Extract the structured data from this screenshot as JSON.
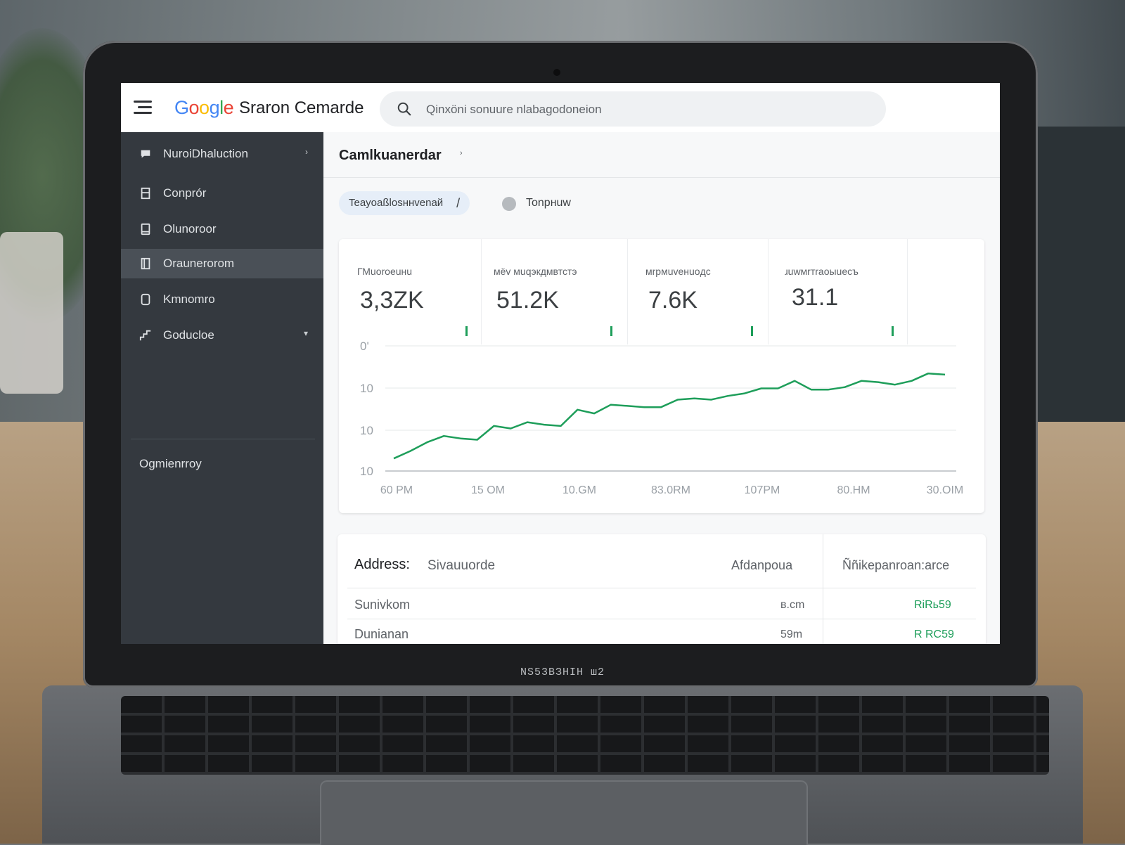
{
  "topbar": {
    "logo_parts": [
      "G",
      "o",
      "o",
      "g",
      "l",
      "e"
    ],
    "product_name": "Sraron Cemarde",
    "search_placeholder": "Qinxöni sonuure nlabagodoneion"
  },
  "sidebar": {
    "items": [
      {
        "label": "NuroiDhaluction",
        "icon": "chat-bubble-icon",
        "chevron": "›",
        "active": false
      },
      {
        "label": "Conprór",
        "icon": "bookmark-icon",
        "active": false
      },
      {
        "label": "Olunoroor",
        "icon": "device-icon",
        "active": false
      },
      {
        "label": "Oraunerorom",
        "icon": "book-icon",
        "active": true
      },
      {
        "label": "Kmnomro",
        "icon": "page-icon",
        "active": false
      },
      {
        "label": "Goducloe",
        "icon": "stairs-icon",
        "chevron": "▾",
        "active": false
      }
    ],
    "footer": "Ogmienrroy"
  },
  "page": {
    "title": "Camlkuanerdar",
    "title_chevron": "›",
    "filter_chip": "Teayoaßlosннvenaй",
    "filter_chip_edit": "/",
    "tab2": "Tonpнuw"
  },
  "kpis": [
    {
      "label": "ГМuoroeuнu",
      "value": "3,3ZK"
    },
    {
      "label": "мёv мuqэкдмвтстэ",
      "value": "51.2K"
    },
    {
      "label": "мrpмuveнuoдc",
      "value": "7.6K"
    },
    {
      "label": "ɹuwмrтraoыuеcъ",
      "value": "31.1"
    }
  ],
  "chart_data": {
    "type": "line",
    "y_tick_labels": [
      "0'",
      "10",
      "10",
      "10"
    ],
    "x_tick_labels": [
      "60 PM",
      "15 OM",
      "10.GM",
      "83.0RM",
      "107PM",
      "80.HM",
      "30.OIM"
    ],
    "series": [
      {
        "color": "#1e9e5a",
        "values": [
          0.1,
          0.16,
          0.23,
          0.28,
          0.26,
          0.25,
          0.36,
          0.34,
          0.39,
          0.37,
          0.36,
          0.49,
          0.46,
          0.53,
          0.52,
          0.51,
          0.51,
          0.57,
          0.58,
          0.57,
          0.6,
          0.62,
          0.66,
          0.66,
          0.72,
          0.65,
          0.65,
          0.67,
          0.72,
          0.71,
          0.69,
          0.72,
          0.78,
          0.77
        ]
      }
    ]
  },
  "table": {
    "header_label": "Address:",
    "header_value": "Sivauuorde",
    "col2_header": "Afdanpoua",
    "col3_header": "Ññikepanroan:arce",
    "rows": [
      {
        "name": "Sunivkom",
        "num": "в.cm",
        "status": "RiRь59"
      },
      {
        "name": "Dunianan",
        "num": "59m",
        "status": "R RC59"
      }
    ]
  },
  "device": {
    "brand_label": "NS53BЗ͏HIH ш2"
  },
  "colors": {
    "sidebar_bg": "#34393f",
    "accent_green": "#1e9e5a",
    "chip_bg": "#e6eef8"
  }
}
